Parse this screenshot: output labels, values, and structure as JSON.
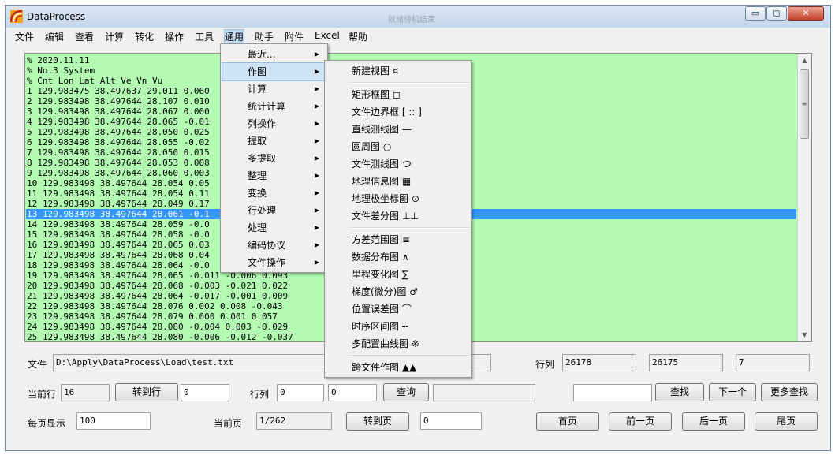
{
  "window": {
    "title": "DataProcess",
    "center_title": "就绪待机结束",
    "minimize": "▭",
    "maximize": "◻",
    "close": "✕"
  },
  "menubar": [
    "文件",
    "编辑",
    "查看",
    "计算",
    "转化",
    "操作",
    "工具",
    "通用",
    "助手",
    "附件",
    "Excel",
    "帮助"
  ],
  "editor": {
    "lines": [
      "% 2020.11.11",
      "% No.3 System",
      "% Cnt Lon Lat Alt Ve Vn Vu",
      "1 129.983475 38.497637 29.011 0.060",
      "2 129.983498 38.497644 28.107 0.010",
      "3 129.983498 38.497644 28.067 0.000",
      "4 129.983498 38.497644 28.065 -0.01",
      "5 129.983498 38.497644 28.050 0.025",
      "6 129.983498 38.497644 28.055 -0.02",
      "7 129.983498 38.497644 28.050 0.015",
      "8 129.983498 38.497644 28.053 0.008",
      "9 129.983498 38.497644 28.060 0.003",
      "10 129.983498 38.497644 28.054 0.05",
      "11 129.983498 38.497644 28.054 0.11",
      "12 129.983498 38.497644 28.049 0.17",
      "13 129.983498 38.497644 28.061 -0.1",
      "14 129.983498 38.497644 28.059 -0.0",
      "15 129.983498 38.497644 28.058 -0.0",
      "16 129.983498 38.497644 28.065 0.03",
      "17 129.983498 38.497644 28.068 0.04",
      "18 129.983498 38.497644 28.064 -0.0",
      "19 129.983498 38.497644 28.065 -0.011 -0.006 0.093",
      "20 129.983498 38.497644 28.068 -0.003 -0.021 0.022",
      "21 129.983498 38.497644 28.064 -0.017 -0.001 0.009",
      "22 129.983498 38.497644 28.076 0.002 0.008 -0.043",
      "23 129.983498 38.497644 28.079 0.000 0.001 0.057",
      "24 129.983498 38.497644 28.080 -0.004 0.003 -0.029",
      "25 129.983498 38.497644 28.080 -0.006 -0.012 -0.037"
    ],
    "selected_line": 16
  },
  "file_row": {
    "label": "文件",
    "path": "D:\\Apply\\DataProcess\\Load\\test.txt",
    "rows_label": "行列",
    "rows_value": "26178",
    "cols_value": "26175",
    "extra_value": "7"
  },
  "row2": {
    "current_row_label": "当前行",
    "current_row_value": "16",
    "goto_row_btn": "转到行",
    "goto_row_input": "0",
    "rowcol_label": "行列",
    "row_input": "0",
    "col_input": "0",
    "query_btn": "查询",
    "find_btn": "查找",
    "next_btn": "下一个",
    "more_find_btn": "更多查找"
  },
  "row3": {
    "per_page_label": "每页显示",
    "per_page_value": "100",
    "current_page_label": "当前页",
    "current_page_value": "1/262",
    "goto_page_btn": "转到页",
    "goto_page_input": "0",
    "first_btn": "首页",
    "prev_btn": "前一页",
    "next_page_btn": "后一页",
    "last_btn": "尾页"
  },
  "tools_menu": [
    {
      "label": "最近...",
      "arrow": "▶"
    },
    {
      "label": "作图",
      "arrow": "▶"
    },
    {
      "label": "计算",
      "arrow": "▶"
    },
    {
      "label": "统计计算",
      "arrow": "▶"
    },
    {
      "label": "列操作",
      "arrow": "▶"
    },
    {
      "label": "提取",
      "arrow": "▶"
    },
    {
      "label": "多提取",
      "arrow": "▶"
    },
    {
      "label": "整理",
      "arrow": "▶"
    },
    {
      "label": "变换",
      "arrow": "▶"
    },
    {
      "label": "行处理",
      "arrow": "▶"
    },
    {
      "label": "处理",
      "arrow": "▶"
    },
    {
      "label": "编码协议",
      "arrow": "▶"
    },
    {
      "label": "文件操作",
      "arrow": "▶"
    }
  ],
  "plot_menu": [
    {
      "label": "新建视图 ¤"
    },
    {
      "label": "矩形框图 ◻"
    },
    {
      "label": "文件边界框 [ :: ]"
    },
    {
      "label": "直线测线图 —"
    },
    {
      "label": "圆周图 ○"
    },
    {
      "label": "文件测线图 つ"
    },
    {
      "label": "地理信息图 ▦"
    },
    {
      "label": "地理极坐标图 ⊙"
    },
    {
      "label": "文件差分图 ⊥⊥"
    },
    {
      "label": "方差范围图 ≡"
    },
    {
      "label": "数据分布图 ∧"
    },
    {
      "label": "里程变化图 ∑"
    },
    {
      "label": "梯度(微分)图 ♂"
    },
    {
      "label": "位置误差图 ⌒"
    },
    {
      "label": "时序区间图 ┅"
    },
    {
      "label": "多配置曲线图 ※"
    },
    {
      "label": "跨文件作图 ▲▲"
    }
  ]
}
